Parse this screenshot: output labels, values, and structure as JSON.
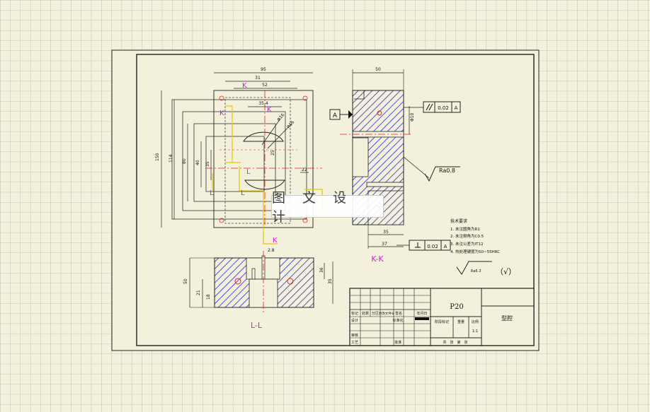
{
  "watermark": "图 文 设 计",
  "material": "P20",
  "part_name": "型腔",
  "roughness_symbol": "Ra6.3",
  "roughness_suffix": "（√）",
  "surface_finish": "Ra0.8",
  "datum": "A",
  "tolerance": {
    "value": "0.02",
    "datum": "A"
  },
  "section_labels": {
    "kk": "K-K",
    "ll": "L-L",
    "k": "K",
    "l": "L"
  },
  "notes": {
    "title": "技术要求",
    "items": [
      "1. 未注圆角为R1",
      "2. 未注倒角为C0.5",
      "3. 未注公差为IT12",
      "4. 热处理硬度为50~55HRC"
    ]
  },
  "dimensions": {
    "top_width": "95",
    "inner_31": "31",
    "inner_52": "52",
    "d_35": "35.4",
    "d_phi16": "Φ16",
    "d_r16": "R16",
    "h_150": "150",
    "h_114": "114",
    "h_80": "80",
    "h_40": "40",
    "h_35": "35",
    "d_22": "22",
    "d_25": "25",
    "side_width": "50",
    "side_phi": "Φ10",
    "side_35": "35",
    "side_37": "37",
    "bot_28": "2.8",
    "bot_50": "50",
    "bot_21": "21",
    "bot_36": "36",
    "bot_18": "18",
    "bot_35": "35"
  },
  "title_block": {
    "headers": [
      "标记",
      "处数",
      "分区",
      "更改文件号",
      "签名",
      "年月日"
    ],
    "design": "设计",
    "standard": "标准化",
    "stage_label": "阶段标记",
    "weight": "重量",
    "scale": "比例",
    "scale_value": "1:1",
    "review": "审核",
    "process": "工艺",
    "approve": "批准",
    "sheet": "共　张　第　张"
  }
}
